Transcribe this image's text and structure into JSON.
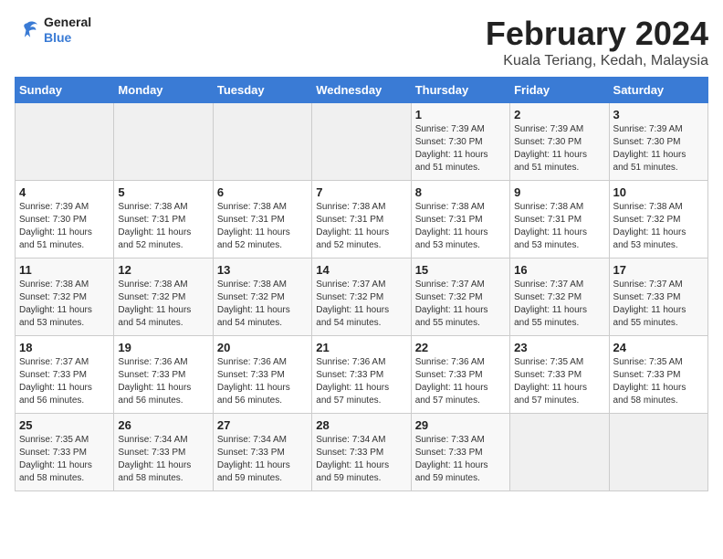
{
  "logo": {
    "text_general": "General",
    "text_blue": "Blue"
  },
  "title": "February 2024",
  "subtitle": "Kuala Teriang, Kedah, Malaysia",
  "days_of_week": [
    "Sunday",
    "Monday",
    "Tuesday",
    "Wednesday",
    "Thursday",
    "Friday",
    "Saturday"
  ],
  "weeks": [
    [
      {
        "day": "",
        "info": ""
      },
      {
        "day": "",
        "info": ""
      },
      {
        "day": "",
        "info": ""
      },
      {
        "day": "",
        "info": ""
      },
      {
        "day": "1",
        "info": "Sunrise: 7:39 AM\nSunset: 7:30 PM\nDaylight: 11 hours\nand 51 minutes."
      },
      {
        "day": "2",
        "info": "Sunrise: 7:39 AM\nSunset: 7:30 PM\nDaylight: 11 hours\nand 51 minutes."
      },
      {
        "day": "3",
        "info": "Sunrise: 7:39 AM\nSunset: 7:30 PM\nDaylight: 11 hours\nand 51 minutes."
      }
    ],
    [
      {
        "day": "4",
        "info": "Sunrise: 7:39 AM\nSunset: 7:30 PM\nDaylight: 11 hours\nand 51 minutes."
      },
      {
        "day": "5",
        "info": "Sunrise: 7:38 AM\nSunset: 7:31 PM\nDaylight: 11 hours\nand 52 minutes."
      },
      {
        "day": "6",
        "info": "Sunrise: 7:38 AM\nSunset: 7:31 PM\nDaylight: 11 hours\nand 52 minutes."
      },
      {
        "day": "7",
        "info": "Sunrise: 7:38 AM\nSunset: 7:31 PM\nDaylight: 11 hours\nand 52 minutes."
      },
      {
        "day": "8",
        "info": "Sunrise: 7:38 AM\nSunset: 7:31 PM\nDaylight: 11 hours\nand 53 minutes."
      },
      {
        "day": "9",
        "info": "Sunrise: 7:38 AM\nSunset: 7:31 PM\nDaylight: 11 hours\nand 53 minutes."
      },
      {
        "day": "10",
        "info": "Sunrise: 7:38 AM\nSunset: 7:32 PM\nDaylight: 11 hours\nand 53 minutes."
      }
    ],
    [
      {
        "day": "11",
        "info": "Sunrise: 7:38 AM\nSunset: 7:32 PM\nDaylight: 11 hours\nand 53 minutes."
      },
      {
        "day": "12",
        "info": "Sunrise: 7:38 AM\nSunset: 7:32 PM\nDaylight: 11 hours\nand 54 minutes."
      },
      {
        "day": "13",
        "info": "Sunrise: 7:38 AM\nSunset: 7:32 PM\nDaylight: 11 hours\nand 54 minutes."
      },
      {
        "day": "14",
        "info": "Sunrise: 7:37 AM\nSunset: 7:32 PM\nDaylight: 11 hours\nand 54 minutes."
      },
      {
        "day": "15",
        "info": "Sunrise: 7:37 AM\nSunset: 7:32 PM\nDaylight: 11 hours\nand 55 minutes."
      },
      {
        "day": "16",
        "info": "Sunrise: 7:37 AM\nSunset: 7:32 PM\nDaylight: 11 hours\nand 55 minutes."
      },
      {
        "day": "17",
        "info": "Sunrise: 7:37 AM\nSunset: 7:33 PM\nDaylight: 11 hours\nand 55 minutes."
      }
    ],
    [
      {
        "day": "18",
        "info": "Sunrise: 7:37 AM\nSunset: 7:33 PM\nDaylight: 11 hours\nand 56 minutes."
      },
      {
        "day": "19",
        "info": "Sunrise: 7:36 AM\nSunset: 7:33 PM\nDaylight: 11 hours\nand 56 minutes."
      },
      {
        "day": "20",
        "info": "Sunrise: 7:36 AM\nSunset: 7:33 PM\nDaylight: 11 hours\nand 56 minutes."
      },
      {
        "day": "21",
        "info": "Sunrise: 7:36 AM\nSunset: 7:33 PM\nDaylight: 11 hours\nand 57 minutes."
      },
      {
        "day": "22",
        "info": "Sunrise: 7:36 AM\nSunset: 7:33 PM\nDaylight: 11 hours\nand 57 minutes."
      },
      {
        "day": "23",
        "info": "Sunrise: 7:35 AM\nSunset: 7:33 PM\nDaylight: 11 hours\nand 57 minutes."
      },
      {
        "day": "24",
        "info": "Sunrise: 7:35 AM\nSunset: 7:33 PM\nDaylight: 11 hours\nand 58 minutes."
      }
    ],
    [
      {
        "day": "25",
        "info": "Sunrise: 7:35 AM\nSunset: 7:33 PM\nDaylight: 11 hours\nand 58 minutes."
      },
      {
        "day": "26",
        "info": "Sunrise: 7:34 AM\nSunset: 7:33 PM\nDaylight: 11 hours\nand 58 minutes."
      },
      {
        "day": "27",
        "info": "Sunrise: 7:34 AM\nSunset: 7:33 PM\nDaylight: 11 hours\nand 59 minutes."
      },
      {
        "day": "28",
        "info": "Sunrise: 7:34 AM\nSunset: 7:33 PM\nDaylight: 11 hours\nand 59 minutes."
      },
      {
        "day": "29",
        "info": "Sunrise: 7:33 AM\nSunset: 7:33 PM\nDaylight: 11 hours\nand 59 minutes."
      },
      {
        "day": "",
        "info": ""
      },
      {
        "day": "",
        "info": ""
      }
    ]
  ]
}
